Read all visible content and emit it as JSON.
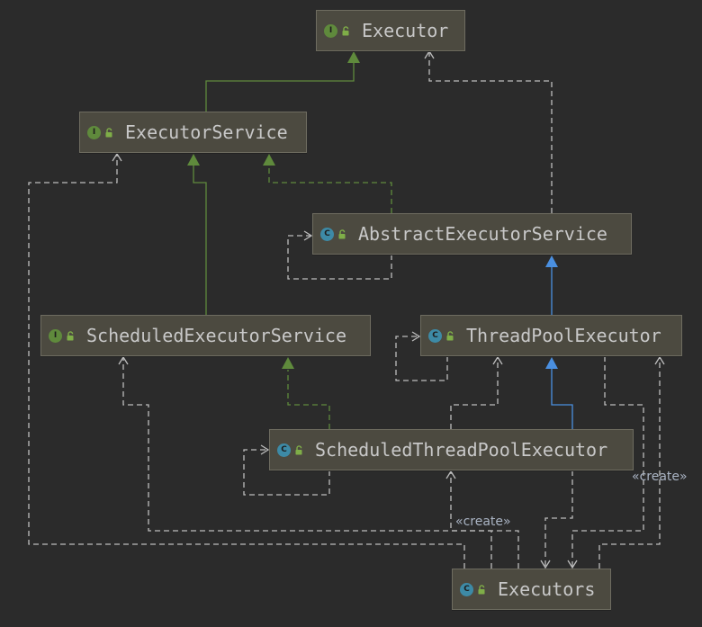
{
  "nodes": {
    "executor": {
      "name": "Executor",
      "kind": "I"
    },
    "executor_service": {
      "name": "ExecutorService",
      "kind": "I"
    },
    "abstract_executor_service": {
      "name": "AbstractExecutorService",
      "kind": "C"
    },
    "scheduled_executor_service": {
      "name": "ScheduledExecutorService",
      "kind": "I"
    },
    "thread_pool_executor": {
      "name": "ThreadPoolExecutor",
      "kind": "C"
    },
    "scheduled_thread_pool_executor": {
      "name": "ScheduledThreadPoolExecutor",
      "kind": "C"
    },
    "executors": {
      "name": "Executors",
      "kind": "C"
    }
  },
  "edge_labels": {
    "create_tpe": "«create»",
    "create_stpe": "«create»"
  },
  "colors": {
    "extends_interface": "#5f8a3c",
    "extends_class": "#4a8fe0",
    "dependency": "#bdbdbd",
    "lock": "#7fae48"
  }
}
